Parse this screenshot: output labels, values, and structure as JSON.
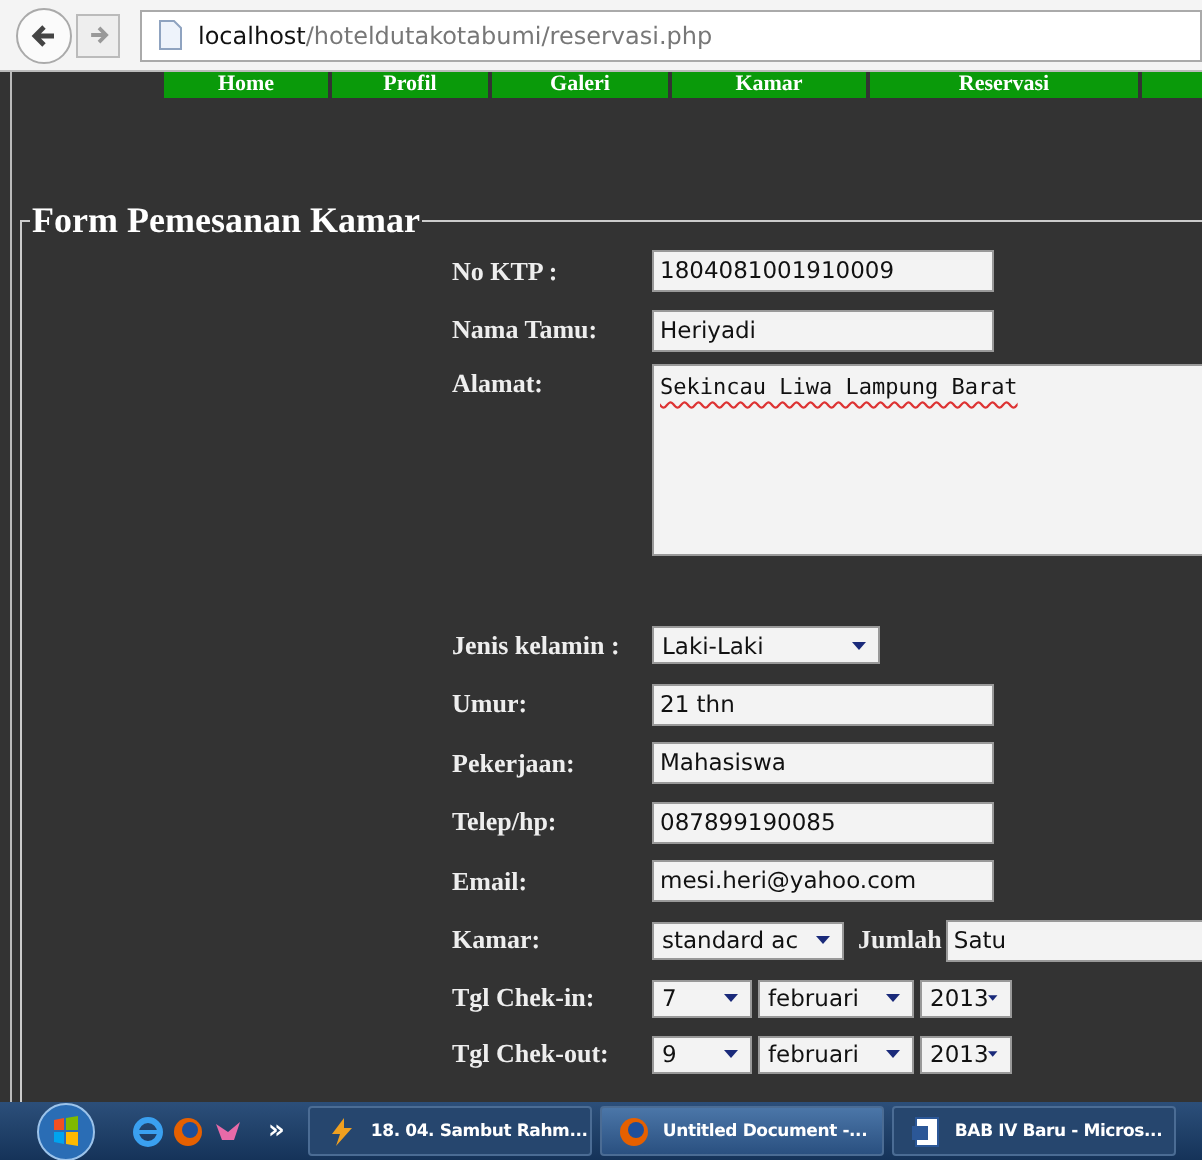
{
  "browser": {
    "url_host": "localhost",
    "url_path": "/hoteldutakotabumi/reservasi.php"
  },
  "nav": [
    {
      "label": "Home"
    },
    {
      "label": "Profil"
    },
    {
      "label": "Galeri"
    },
    {
      "label": "Kamar"
    },
    {
      "label": "Reservasi"
    }
  ],
  "form": {
    "legend": "Form Pemesanan Kamar",
    "fields": [
      {
        "kind": "text",
        "label": "No KTP :",
        "value": "1804081001910009"
      },
      {
        "kind": "text",
        "label": "Nama Tamu:",
        "value": "Heriyadi"
      },
      {
        "kind": "textarea",
        "label": "Alamat:",
        "value": "Sekincau Liwa Lampung Barat"
      },
      {
        "kind": "select",
        "label": "Jenis kelamin :",
        "value": "Laki-Laki"
      },
      {
        "kind": "text",
        "label": "Umur:",
        "value": "21 thn"
      },
      {
        "kind": "text",
        "label": "Pekerjaan:",
        "value": "Mahasiswa"
      },
      {
        "kind": "text",
        "label": "Telep/hp:",
        "value": "087899190085"
      },
      {
        "kind": "text",
        "label": "Email:",
        "value": "mesi.heri@yahoo.com"
      },
      {
        "kind": "room",
        "label": "Kamar:",
        "value": "standard ac",
        "extra_label": "Jumlah",
        "extra_value": "Satu"
      },
      {
        "kind": "date",
        "label": "Tgl Chek-in:",
        "parts": [
          "7",
          "februari",
          "2013"
        ]
      },
      {
        "kind": "date",
        "label": "Tgl Chek-out:",
        "parts": [
          "9",
          "februari",
          "2013"
        ]
      }
    ]
  },
  "taskbar": {
    "more": "»",
    "tasks": [
      {
        "kind": "media",
        "label": "18. 04. Sambut Rahm...",
        "selected": false
      },
      {
        "kind": "browser",
        "label": "Untitled Document -...",
        "selected": true
      },
      {
        "kind": "document",
        "label": "BAB IV Baru - Micros...",
        "selected": false
      }
    ]
  }
}
